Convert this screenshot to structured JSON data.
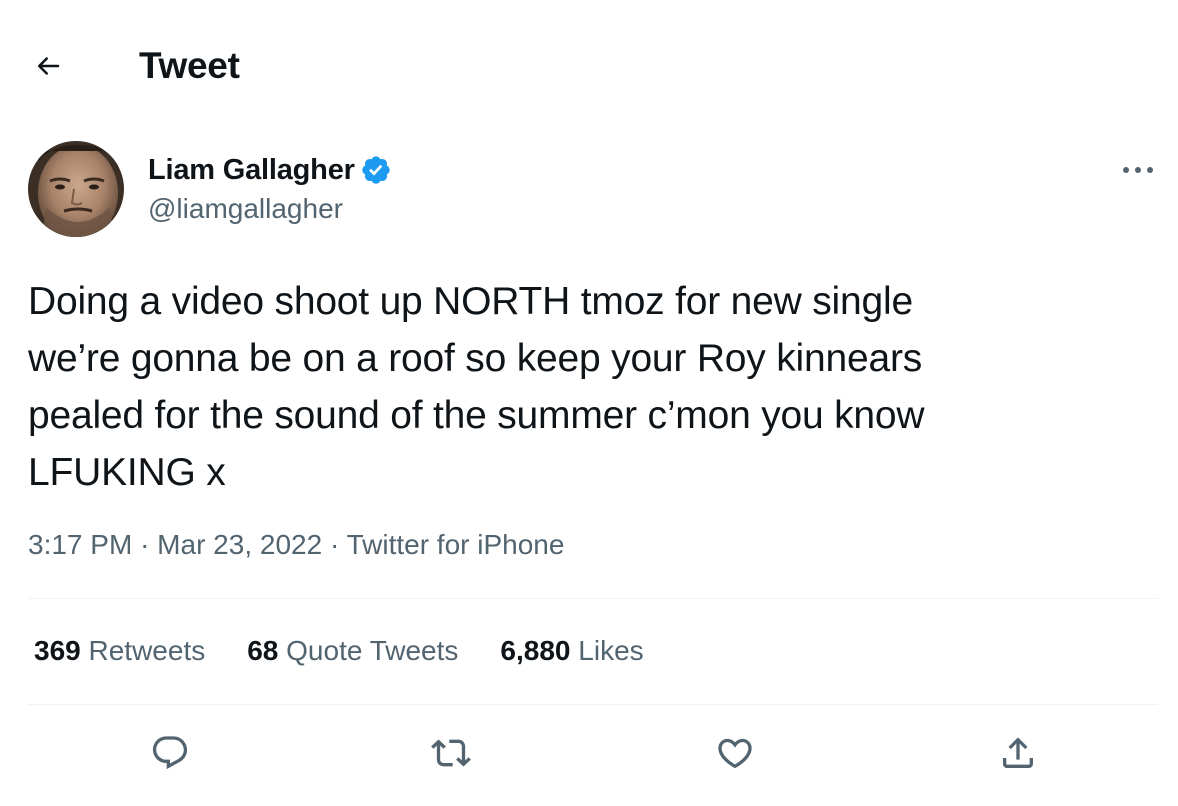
{
  "header": {
    "title": "Tweet",
    "back_icon": "arrow-left-icon"
  },
  "author": {
    "display_name": "Liam Gallagher",
    "handle": "@liamgallagher",
    "verified": true,
    "verified_icon": "verified-badge-icon",
    "more_icon": "more-horizontal-icon"
  },
  "tweet": {
    "text": "Doing a video shoot up NORTH tmoz for new single\nwe’re gonna be on a roof so keep your Roy kinnears\npealed for the sound of the summer c’mon you know\nLFUKING x",
    "time": "3:17 PM",
    "date": "Mar 23, 2022",
    "source": "Twitter for iPhone",
    "separator": "·"
  },
  "stats": {
    "retweets_count": "369",
    "retweets_label": "Retweets",
    "quotes_count": "68",
    "quotes_label": "Quote Tweets",
    "likes_count": "6,880",
    "likes_label": "Likes"
  },
  "actions": {
    "reply_icon": "reply-icon",
    "retweet_icon": "retweet-icon",
    "like_icon": "heart-icon",
    "share_icon": "share-icon"
  },
  "colors": {
    "text_primary": "#0f1419",
    "text_secondary": "#536471",
    "verified_blue": "#1d9bf0",
    "divider": "#eff3f4"
  }
}
